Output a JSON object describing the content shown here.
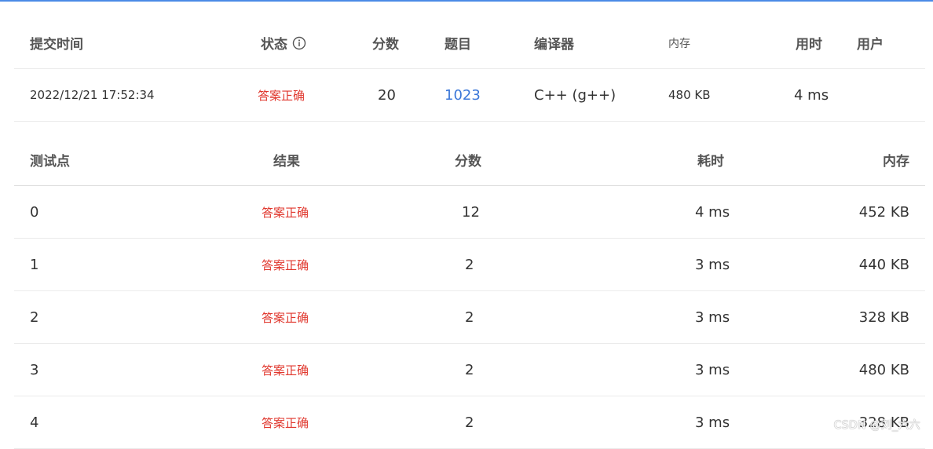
{
  "submission": {
    "headers": {
      "submit_time": "提交时间",
      "status": "状态",
      "score": "分数",
      "problem": "题目",
      "compiler": "编译器",
      "memory": "内存",
      "time": "用时",
      "user": "用户"
    },
    "row": {
      "submit_time": "2022/12/21 17:52:34",
      "status": "答案正确",
      "score": "20",
      "problem": "1023",
      "compiler": "C++ (g++)",
      "memory": "480 KB",
      "time": "4 ms",
      "user": ""
    }
  },
  "testcases": {
    "headers": {
      "case": "测试点",
      "result": "结果",
      "score": "分数",
      "time": "耗时",
      "memory": "内存"
    },
    "rows": [
      {
        "case": "0",
        "result": "答案正确",
        "score": "12",
        "time": "4 ms",
        "memory": "452 KB"
      },
      {
        "case": "1",
        "result": "答案正确",
        "score": "2",
        "time": "3 ms",
        "memory": "440 KB"
      },
      {
        "case": "2",
        "result": "答案正确",
        "score": "2",
        "time": "3 ms",
        "memory": "328 KB"
      },
      {
        "case": "3",
        "result": "答案正确",
        "score": "2",
        "time": "3 ms",
        "memory": "480 KB"
      },
      {
        "case": "4",
        "result": "答案正确",
        "score": "2",
        "time": "3 ms",
        "memory": "328 KB"
      }
    ]
  },
  "watermark": "CSDN @刘_六六",
  "colors": {
    "accent_border": "#4a8ae6",
    "status_ok": "#e0362c",
    "link": "#3b77d8"
  },
  "icons": {
    "status_info": "info-circle-icon"
  }
}
